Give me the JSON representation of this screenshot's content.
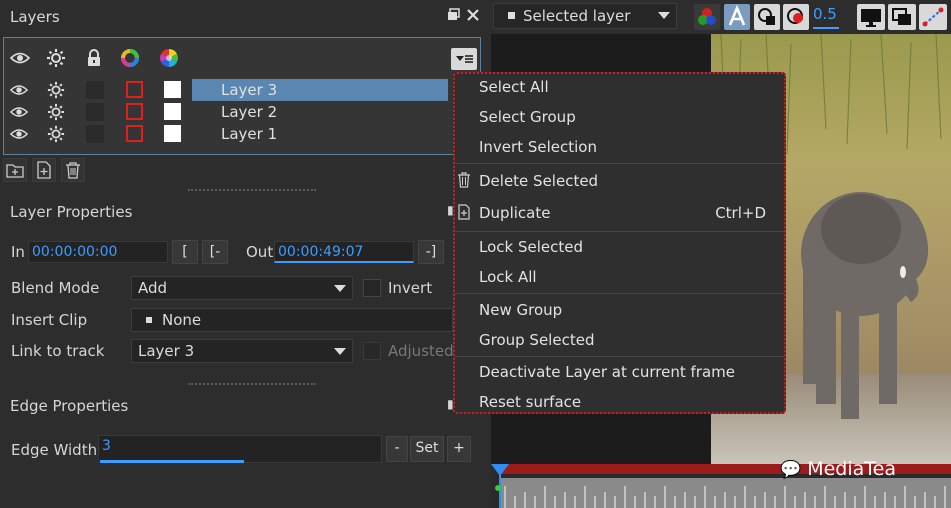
{
  "panel": {
    "title": "Layers"
  },
  "layers": [
    {
      "name": "Layer 3",
      "selected": true
    },
    {
      "name": "Layer 2",
      "selected": false
    },
    {
      "name": "Layer 1",
      "selected": false
    }
  ],
  "layer_properties": {
    "title": "Layer Properties",
    "in_label": "In",
    "in_value": "00:00:00:00",
    "in_btn1": "[",
    "in_btn2": "[-",
    "out_label": "Out",
    "out_value": "00:00:49:07",
    "out_btn": "-]",
    "blend_label": "Blend Mode",
    "blend_value": "Add",
    "invert_label": "Invert",
    "insert_clip_label": "Insert Clip",
    "insert_clip_value": "None",
    "link_label": "Link to track",
    "link_value": "Layer 3",
    "adjusted_label": "Adjusted"
  },
  "edge_properties": {
    "title": "Edge Properties",
    "width_label": "Edge Width",
    "width_value": "3",
    "minus": "-",
    "set": "Set",
    "plus": "+"
  },
  "toolbar": {
    "dropdown_value": "Selected layer",
    "opacity_value": "0.5"
  },
  "context_menu": {
    "items": [
      {
        "label": "Select All"
      },
      {
        "label": "Select Group"
      },
      {
        "label": "Invert Selection"
      },
      {
        "label": "Delete Selected",
        "icon": "trash-icon"
      },
      {
        "label": "Duplicate",
        "icon": "duplicate-icon",
        "shortcut": "Ctrl+D"
      },
      {
        "label": "Lock Selected"
      },
      {
        "label": "Lock All"
      },
      {
        "label": "New Group"
      },
      {
        "label": "Group Selected"
      },
      {
        "label": "Deactivate Layer at current frame"
      },
      {
        "label": "Reset surface"
      }
    ]
  },
  "watermark": "MediaTea",
  "colors": {
    "selection": "#5a87b2",
    "accent_blue": "#3d9cff",
    "red_outline": "#e01e1e",
    "timeline_red": "#9c1c1c"
  }
}
